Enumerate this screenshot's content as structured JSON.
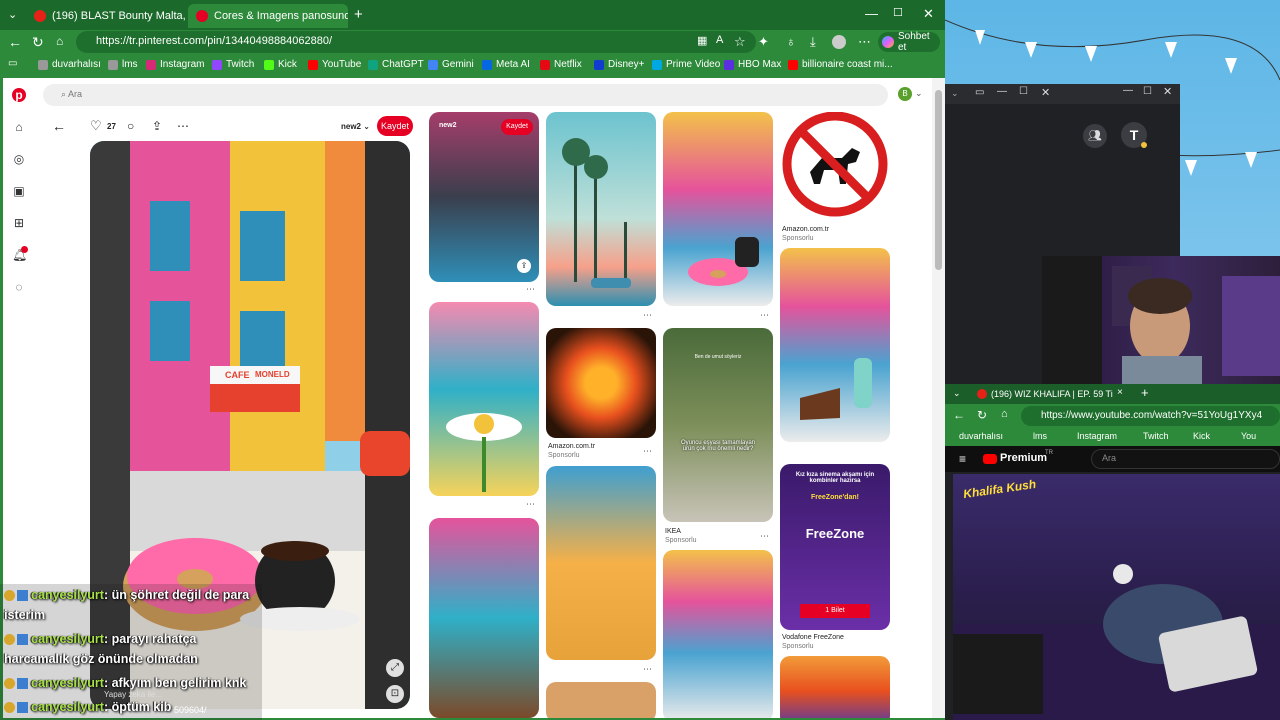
{
  "tabs": [
    {
      "title": "(196) BLAST Bounty Malta, Round",
      "color": "#e62117"
    },
    {
      "title": "Cores & Imagens panosundaki Pin",
      "color": "#e60023"
    }
  ],
  "url": "https://tr.pinterest.com/pin/13440498884062880/",
  "copilot_label": "Sohbet et",
  "bookmarks": [
    "duvarhalısı",
    "lms",
    "Instagram",
    "Twitch",
    "Kick",
    "YouTube",
    "ChatGPT",
    "Gemini",
    "Meta AI",
    "Netflix",
    "Disney+",
    "Prime Video",
    "HBO Max",
    "billionaire coast mi..."
  ],
  "bookmark_colors": [
    "#999",
    "#999",
    "#d62976",
    "#9146ff",
    "#53fc18",
    "#ff0000",
    "#10a37f",
    "#4285f4",
    "#0668e1",
    "#e50914",
    "#113ccf",
    "#00a8e1",
    "#5b2ee0",
    "#ff0000"
  ],
  "pinterest": {
    "search_placeholder": "Ara",
    "avatar_letter": "B",
    "like_count": "27",
    "board_name": "new2",
    "save_label": "Kaydet",
    "overlay_board": "new2",
    "cafe_sign": "CAFE",
    "cafe_sign2": "MONELD",
    "cards": {
      "amazon1_title": "Amazon.com.tr",
      "amazon1_sub": "Sponsorlu",
      "amazon2_title": "Amazon.com.tr",
      "amazon2_sub": "Sponsorlu",
      "ikea_title": "IKEA",
      "ikea_sub": "Sponsorlu",
      "ikea_caption": "Ben de umut söyleriz",
      "ikea_overlay": "Oyuncu eşyası tamamlayan ürün çok mu önemli nedir?",
      "vodafone_title": "Vodafone FreeZone",
      "vodafone_sub": "Sponsorlu",
      "vodafone_text1": "Kız kıza sinema akşamı için kombinler hazırsa",
      "vodafone_text2": "FreeZone'dan!",
      "vodafone_text3": "FreeZone",
      "vodafone_ticket": "1 Bilet"
    }
  },
  "chat": [
    {
      "user": "canyesilyurt",
      "msg": ": ün şöhret değil de para",
      "cont": "isterim"
    },
    {
      "user": "canyesilyurt",
      "msg": ": parayı rahatça",
      "cont": "harcamalık göz önünde olmadan"
    },
    {
      "user": "canyesilyurt",
      "msg": ": afkyım ben gelirim knk",
      "cont": ""
    },
    {
      "user": "canyesilyurt",
      "msg": ": öptüm kib",
      "cont": ""
    }
  ],
  "chat_hint": "Yapay zeka ile...",
  "chat_code": "509604/",
  "right": {
    "avatar_letter": "T",
    "yt_tab": "(196) WIZ KHALIFA | EP. 59 Ti",
    "yt_url": "https://www.youtube.com/watch?v=51YoUg1YXy4",
    "yt_bookmarks": [
      "duvarhalısı",
      "lms",
      "Instagram",
      "Twitch",
      "Kick",
      "You"
    ],
    "yt_logo": "Premium",
    "yt_logo_sup": "TR",
    "yt_search": "Ara",
    "video_logo": "Khalifa Kush"
  }
}
